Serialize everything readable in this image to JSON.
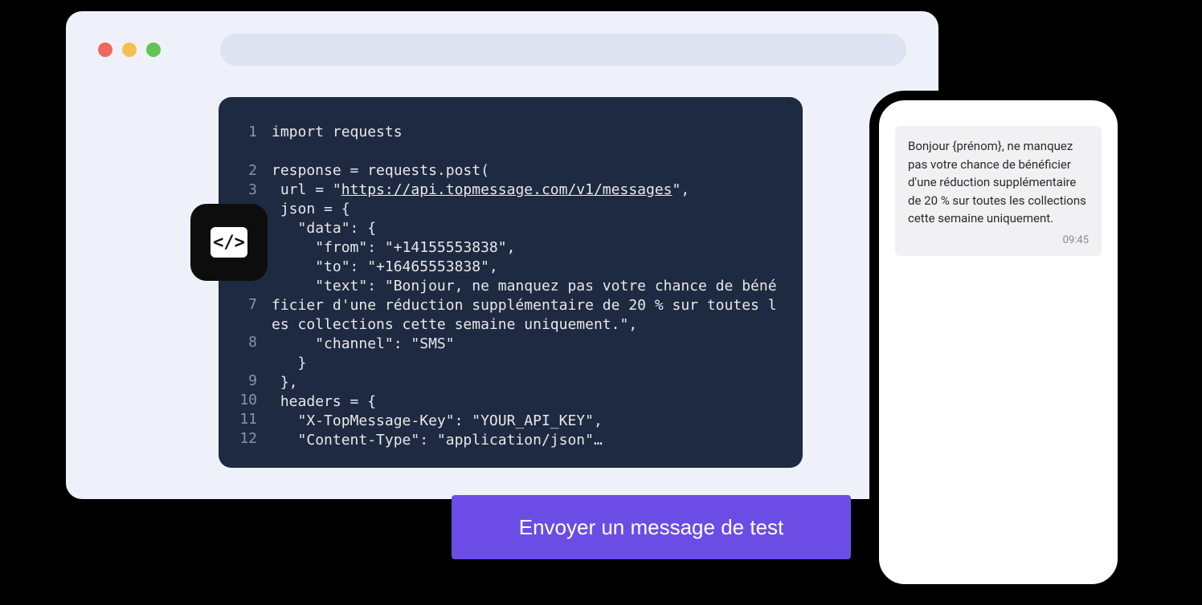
{
  "code": {
    "line_numbers": [
      "1",
      "2",
      "3",
      "",
      "",
      "",
      "",
      "7",
      "8",
      "9",
      "10",
      "11",
      "12"
    ],
    "lines": [
      "import requests",
      "",
      "response = requests.post(",
      " url = \"",
      "https://api.topmessage.com/v1/messages",
      "\",",
      " json = {",
      "   \"data\": {",
      "     \"from\": \"+14155553838\",",
      "     \"to\": \"+16465553838\",",
      "     \"text\": \"Bonjour, ne manquez pas votre chance de bénéficier d'une réduction supplémentaire de 20 % sur toutes les collections cette semaine uniquement.\",",
      "     \"channel\": \"SMS\"",
      "   }",
      " },",
      " headers = {",
      "   \"X-TopMessage-Key\": \"YOUR_API_KEY\",",
      "   \"Content-Type\": \"application/json\"…"
    ],
    "url_segment": "https://api.topmessage.com/v1/messages"
  },
  "cta": {
    "label": "Envoyer un message de test"
  },
  "sms": {
    "text": "Bonjour {prénom}, ne manquez pas votre chance de bénéficier d'une réduction supplémentaire de 20 % sur toutes les collections cette semaine uniquement.",
    "time": "09:45"
  },
  "code_icon": {
    "glyph": "</>"
  }
}
